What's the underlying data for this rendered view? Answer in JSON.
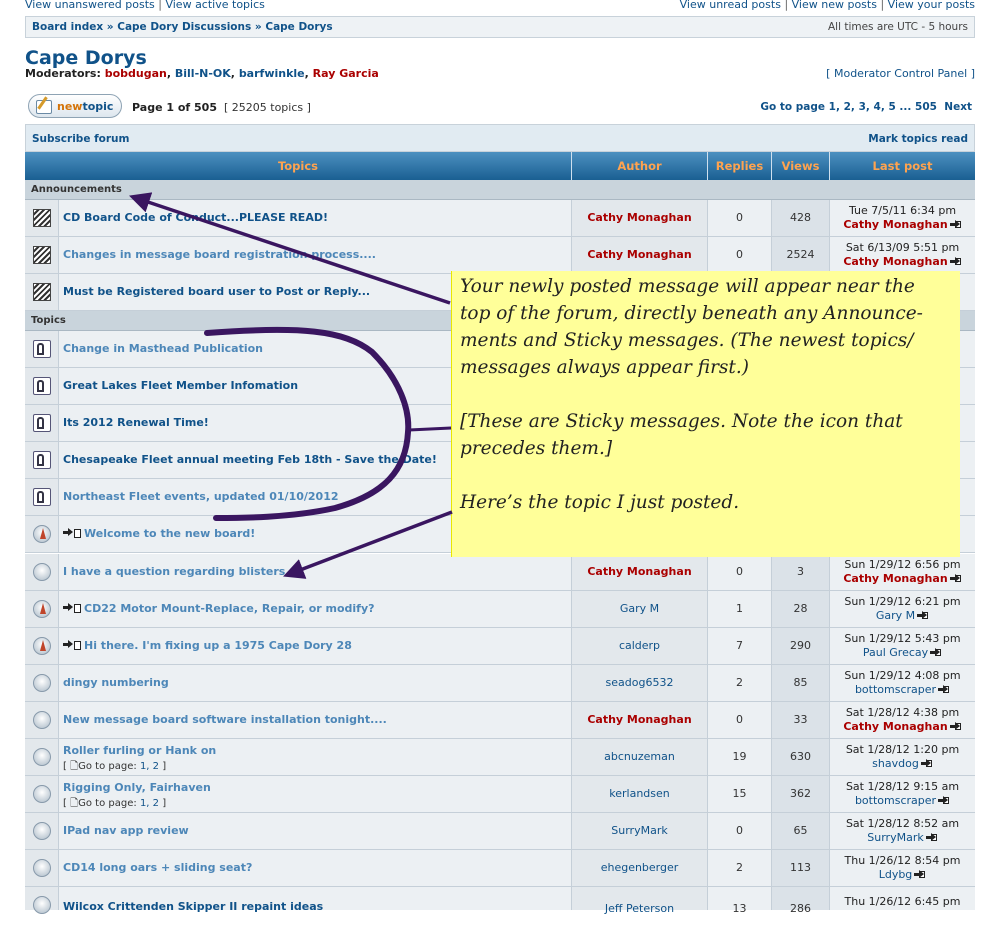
{
  "top_links": {
    "left": [
      "View unanswered posts",
      "View active topics"
    ],
    "right": [
      "View unread posts",
      "View new posts",
      "View your posts"
    ]
  },
  "breadcrumb": {
    "items": [
      "Board index",
      "Cape Dory Discussions",
      "Cape Dorys"
    ],
    "timezone": "All times are UTC - 5 hours"
  },
  "forum": {
    "title": "Cape Dorys",
    "moderators_label": "Moderators:",
    "moderators": [
      {
        "name": "bobdugan",
        "color": "#aa0000"
      },
      {
        "name": "Bill-N-OK",
        "color": "#105289"
      },
      {
        "name": "barfwinkle",
        "color": "#105289"
      },
      {
        "name": "Ray Garcia",
        "color": "#aa0000"
      }
    ],
    "mcp_link": "Moderator Control Panel"
  },
  "toolbar": {
    "new_topic_prefix": "new",
    "new_topic_suffix": "topic",
    "page_info_bold": "Page 1 of 505",
    "topic_count": "25205 topics",
    "goto_label": "Go to page",
    "goto_pages": "1, 2, 3, 4, 5 ... 505",
    "next_label": "Next",
    "subscribe": "Subscribe forum",
    "mark_read": "Mark topics read"
  },
  "table": {
    "headers": {
      "topics": "Topics",
      "author": "Author",
      "replies": "Replies",
      "views": "Views",
      "last_post": "Last post"
    },
    "section_announcements": "Announcements",
    "section_topics": "Topics",
    "announcements": [
      {
        "title": "CD Board Code of Conduct...PLEASE READ!",
        "author": "Cathy Monaghan",
        "replies": "0",
        "views": "428",
        "last_date": "Tue 7/5/11 6:34 pm",
        "last_by": "Cathy Monaghan"
      },
      {
        "title": "Changes in message board registration process....",
        "author": "Cathy Monaghan",
        "replies": "0",
        "views": "2524",
        "last_date": "Sat 6/13/09 5:51 pm",
        "last_by": "Cathy Monaghan"
      },
      {
        "title": "Must be Registered board user to Post or Reply...",
        "author": "",
        "replies": "",
        "views": "",
        "last_date": "",
        "last_by": ""
      }
    ],
    "topics": [
      {
        "title": "Change in Masthead Publication"
      },
      {
        "title": "Great Lakes Fleet Member Infomation"
      },
      {
        "title": "Its 2012 Renewal Time!"
      },
      {
        "title": "Chesapeake Fleet annual meeting Feb 18th - Save the Date!"
      },
      {
        "title": "Northeast Fleet events, updated 01/10/2012"
      },
      {
        "title": "Welcome to the new board!"
      },
      {
        "title": "I have a question regarding blisters....",
        "author": "Cathy Monaghan",
        "replies": "0",
        "views": "3",
        "last_date": "Sun 1/29/12 6:56 pm",
        "last_by": "Cathy Monaghan"
      },
      {
        "title": "CD22 Motor Mount-Replace, Repair, or modify?",
        "author": "Gary M",
        "replies": "1",
        "views": "28",
        "last_date": "Sun 1/29/12 6:21 pm",
        "last_by": "Gary M"
      },
      {
        "title": "Hi there. I'm fixing up a 1975 Cape Dory 28",
        "author": "calderp",
        "replies": "7",
        "views": "290",
        "last_date": "Sun 1/29/12 5:43 pm",
        "last_by": "Paul Grecay"
      },
      {
        "title": "dingy numbering",
        "author": "seadog6532",
        "replies": "2",
        "views": "85",
        "last_date": "Sun 1/29/12 4:08 pm",
        "last_by": "bottomscraper"
      },
      {
        "title": "New message board software installation tonight....",
        "author": "Cathy Monaghan",
        "replies": "0",
        "views": "33",
        "last_date": "Sat 1/28/12 4:38 pm",
        "last_by": "Cathy Monaghan"
      },
      {
        "title": "Roller furling or Hank on",
        "goto": "Go to page:",
        "pages": "1, 2",
        "author": "abcnuzeman",
        "replies": "19",
        "views": "630",
        "last_date": "Sat 1/28/12 1:20 pm",
        "last_by": "shavdog"
      },
      {
        "title": "Rigging Only, Fairhaven",
        "goto": "Go to page:",
        "pages": "1, 2",
        "author": "kerlandsen",
        "replies": "15",
        "views": "362",
        "last_date": "Sat 1/28/12 9:15 am",
        "last_by": "bottomscraper"
      },
      {
        "title": "IPad nav app review",
        "author": "SurryMark",
        "replies": "0",
        "views": "65",
        "last_date": "Sat 1/28/12 8:52 am",
        "last_by": "SurryMark"
      },
      {
        "title": "CD14 long oars + sliding seat?",
        "author": "ehegenberger",
        "replies": "2",
        "views": "113",
        "last_date": "Thu 1/26/12 8:54 pm",
        "last_by": "Ldybg"
      },
      {
        "title": "Wilcox Crittenden Skipper II repaint ideas",
        "author": "Jeff Peterson",
        "replies": "13",
        "views": "286",
        "last_date": "Thu 1/26/12 6:45 pm",
        "last_by": ""
      }
    ]
  },
  "annotation": {
    "lines": [
      "Your newly posted message will appear near the",
      "top of the forum, directly beneath any Announce-",
      "ments and Sticky messages.  (The newest topics/",
      "messages always appear first.)",
      "[These are Sticky messages.  Note the icon that",
      "precedes them.]",
      "Here’s the topic I just posted."
    ],
    "ink_color": "#3a1660"
  }
}
